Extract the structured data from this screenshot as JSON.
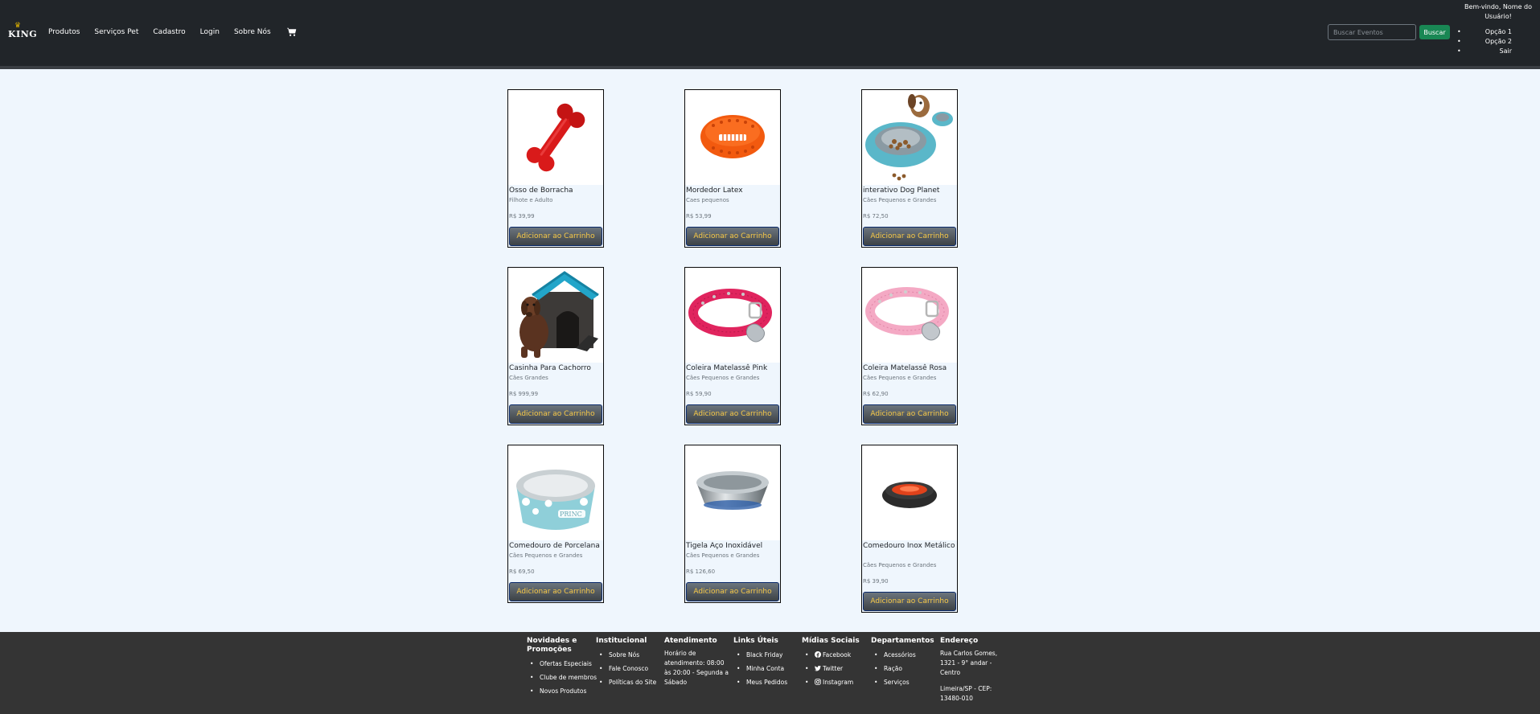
{
  "navbar": {
    "logo_text": "KING",
    "links": [
      "Produtos",
      "Serviços Pet",
      "Cadastro",
      "Login",
      "Sobre Nós"
    ],
    "search_placeholder": "Buscar Eventos",
    "search_button": "Buscar",
    "welcome": "Bem-vindo, Nome do Usuário!",
    "user_menu": [
      "Opção 1",
      "Opção 2",
      "Sair"
    ]
  },
  "products": [
    {
      "title": "Osso de Borracha",
      "subtitle": "Filhote e Adulto",
      "price": "R$ 39,99",
      "button": "Adicionar ao Carrinho",
      "image": "rubber-bone-image"
    },
    {
      "title": "Mordedor Latex",
      "subtitle": "Caes pequenos",
      "price": "R$ 53,99",
      "button": "Adicionar ao Carrinho",
      "image": "latex-football-image"
    },
    {
      "title": "interativo Dog Planet",
      "subtitle": "Cães Pequenos e Grandes",
      "price": "R$ 72,50",
      "button": "Adicionar ao Carrinho",
      "image": "interactive-feeder-image"
    },
    {
      "title": "Casinha Para Cachorro",
      "subtitle": "Cães Grandes",
      "price": "R$ 999,99",
      "button": "Adicionar ao Carrinho",
      "image": "dog-house-image"
    },
    {
      "title": "Coleira Matelassê Pink",
      "subtitle": "Cães Pequenos e Grandes",
      "price": "R$ 59,90",
      "button": "Adicionar ao Carrinho",
      "image": "pink-collar-image"
    },
    {
      "title": "Coleira Matelassê Rosa",
      "subtitle": "Cães Pequenos e Grandes",
      "price": "R$ 62,90",
      "button": "Adicionar ao Carrinho",
      "image": "rose-collar-image"
    },
    {
      "title": "Comedouro de Porcelana",
      "subtitle": "Cães Pequenos e Grandes",
      "price": "R$ 69,50",
      "button": "Adicionar ao Carrinho",
      "image": "porcelain-bowl-image"
    },
    {
      "title": "Tigela Aço Inoxidável",
      "subtitle": "Cães Pequenos e Grandes",
      "price": "R$ 126,60",
      "button": "Adicionar ao Carrinho",
      "image": "steel-bowl-image"
    },
    {
      "title": "Comedouro Inox Metálico",
      "subtitle": "Cães Pequenos e Grandes",
      "price": "R$ 39,90",
      "button": "Adicionar ao Carrinho",
      "image": "metal-bowl-image"
    }
  ],
  "footer": {
    "novidades": {
      "title": "Novidades e Promoções",
      "items": [
        "Ofertas Especiais",
        "Clube de membros",
        "Novos Produtos"
      ]
    },
    "institucional": {
      "title": "Institucional",
      "items": [
        "Sobre Nós",
        "Fale Conosco",
        "Políticas do Site"
      ]
    },
    "atendimento": {
      "title": "Atendimento",
      "text": "Horário de atendimento: 08:00 às 20:00 - Segunda a Sábado"
    },
    "links_uteis": {
      "title": "Links Úteis",
      "items": [
        "Black Friday",
        "Minha Conta",
        "Meus Pedidos"
      ]
    },
    "midias": {
      "title": "Mídias Sociais",
      "items": [
        "Facebook",
        "Twitter",
        "Instagram"
      ]
    },
    "departamentos": {
      "title": "Departamentos",
      "items": [
        "Acessórios",
        "Ração",
        "Serviços"
      ]
    },
    "endereco": {
      "title": "Endereço",
      "line1": "Rua Carlos Gomes, 1321 - 9° andar - Centro",
      "line2": "Limeira/SP - CEP: 13480-010"
    }
  },
  "colors": {
    "navbar": "#212529",
    "page_bg": "#eff6fd",
    "button_text": "#f7c948",
    "search_button": "#198754",
    "footer": "#343434"
  }
}
